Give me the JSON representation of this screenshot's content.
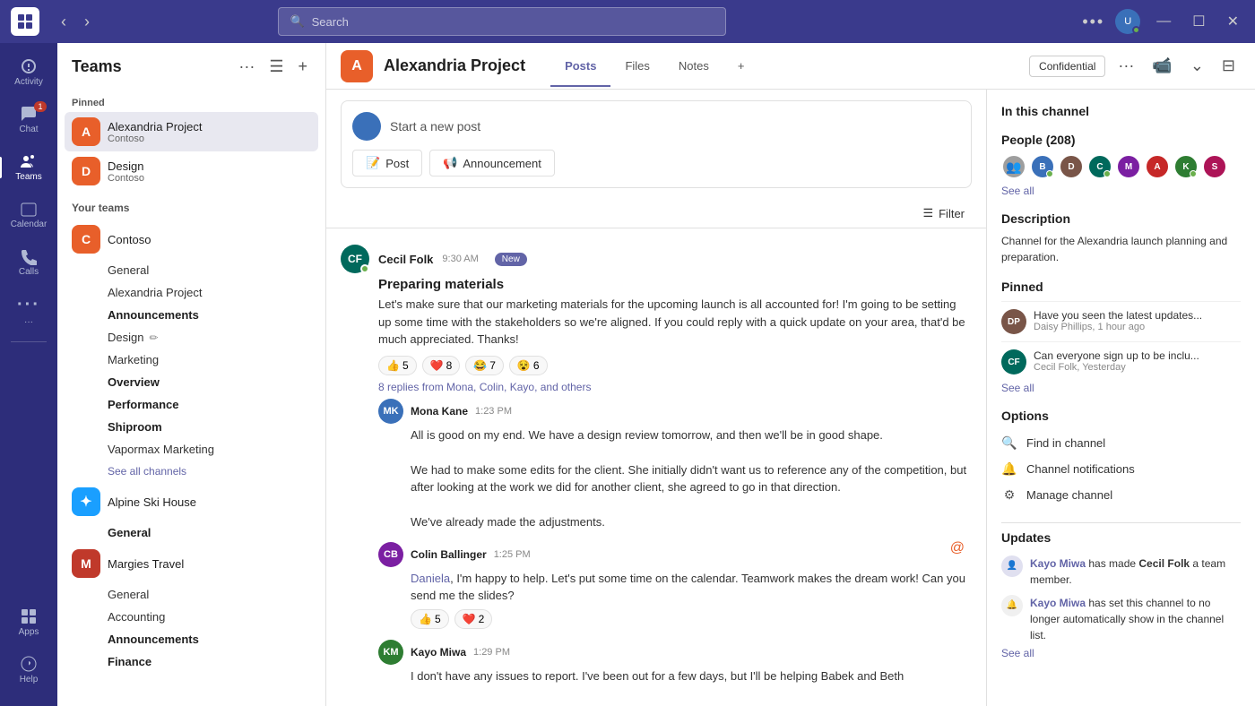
{
  "titlebar": {
    "logo_text": "T",
    "search_placeholder": "Search",
    "dots_label": "•••",
    "avatar_initials": "U",
    "window_minimize": "—",
    "window_maximize": "☐",
    "window_close": "✕"
  },
  "sidebar_icons": {
    "items": [
      {
        "name": "activity",
        "label": "Activity",
        "badge": null
      },
      {
        "name": "chat",
        "label": "Chat",
        "badge": "1"
      },
      {
        "name": "teams",
        "label": "Teams",
        "badge": null
      },
      {
        "name": "calendar",
        "label": "Calendar",
        "badge": null
      },
      {
        "name": "calls",
        "label": "Calls",
        "badge": null
      },
      {
        "name": "more",
        "label": "•••",
        "badge": null
      }
    ],
    "bottom": [
      {
        "name": "apps",
        "label": "Apps",
        "badge": null
      },
      {
        "name": "help",
        "label": "Help",
        "badge": null
      }
    ]
  },
  "teams_nav": {
    "title": "Teams",
    "pinned_label": "Pinned",
    "pinned_items": [
      {
        "name": "Alexandria Project",
        "subtitle": "Contoso",
        "color": "av-orange",
        "initials": "A"
      },
      {
        "name": "Design",
        "subtitle": "Contoso",
        "color": "av-orange",
        "initials": "D"
      }
    ],
    "your_teams_label": "Your teams",
    "teams": [
      {
        "name": "Contoso",
        "color": "av-orange",
        "initials": "C",
        "channels": [
          {
            "name": "General",
            "bold": false
          },
          {
            "name": "Alexandria Project",
            "bold": false
          },
          {
            "name": "Announcements",
            "bold": true
          },
          {
            "name": "Design",
            "bold": false,
            "icon": "✏"
          },
          {
            "name": "Marketing",
            "bold": false
          },
          {
            "name": "Overview",
            "bold": true
          },
          {
            "name": "Performance",
            "bold": true
          },
          {
            "name": "Shiproom",
            "bold": true
          },
          {
            "name": "Vapormax Marketing",
            "bold": false
          }
        ],
        "see_all": "See all channels"
      },
      {
        "name": "Alpine Ski House",
        "color": "av-ski",
        "initials": "✦",
        "channels": [
          {
            "name": "General",
            "bold": true
          }
        ]
      },
      {
        "name": "Margies Travel",
        "color": "av-margies",
        "initials": "M",
        "channels": [
          {
            "name": "General",
            "bold": false
          },
          {
            "name": "Accounting",
            "bold": false
          },
          {
            "name": "Announcements",
            "bold": true
          },
          {
            "name": "Finance",
            "bold": true
          }
        ]
      }
    ]
  },
  "channel_header": {
    "logo_text": "A",
    "title": "Alexandria Project",
    "tabs": [
      "Posts",
      "Files",
      "Notes",
      "+"
    ],
    "active_tab": "Posts",
    "confidential_label": "Confidential",
    "dots": "•••"
  },
  "new_post": {
    "placeholder": "Start a new post",
    "buttons": [
      {
        "icon": "📝",
        "label": "Post"
      },
      {
        "icon": "📢",
        "label": "Announcement"
      }
    ]
  },
  "filter": {
    "label": "Filter"
  },
  "messages": [
    {
      "id": "msg1",
      "author": "Cecil Folk",
      "initials": "CF",
      "color": "av-teal",
      "time": "9:30 AM",
      "is_new": true,
      "online": true,
      "title": "Preparing materials",
      "body": "Let's make sure that our marketing materials for the upcoming launch is all accounted for! I'm going to be setting up some time with the stakeholders so we're aligned. If you could reply with a quick update on your area, that'd be much appreciated. Thanks!",
      "reactions": [
        {
          "emoji": "👍",
          "count": "5"
        },
        {
          "emoji": "❤️",
          "count": "8"
        },
        {
          "emoji": "😂",
          "count": "7"
        },
        {
          "emoji": "😵",
          "count": "6"
        }
      ],
      "replies_text": "8 replies from Mona, Colin, Kayo, and others",
      "replies": [
        {
          "author": "Mona Kane",
          "initials": "MK",
          "color": "av-blue",
          "time": "1:23 PM",
          "body_lines": [
            "All is good on my end. We have a design review tomorrow, and then we'll be in good shape.",
            "We had to make some edits for the client. She initially didn't want us to reference any of the competition, but after looking at the work we did for another client, she agreed to go in that direction.",
            "We've already made the adjustments."
          ],
          "mention": null,
          "reactions": []
        },
        {
          "author": "Colin Ballinger",
          "initials": "CB",
          "color": "av-purple",
          "time": "1:25 PM",
          "body_prefix": "",
          "mention": "Daniela",
          "body_after": ", I'm happy to help. Let's put some time on the calendar. Teamwork makes the dream work! Can you send me the slides?",
          "at_mention": true,
          "reactions": [
            {
              "emoji": "👍",
              "count": "5"
            },
            {
              "emoji": "❤️",
              "count": "2"
            }
          ]
        },
        {
          "author": "Kayo Miwa",
          "initials": "KM",
          "color": "av-green",
          "time": "1:29 PM",
          "body": "I don't have any issues to report. I've been out for a few days, but I'll be helping Babek and Beth",
          "reactions": []
        }
      ]
    }
  ],
  "right_panel": {
    "in_this_channel": "In this channel",
    "people_label": "People (208)",
    "people_count": "208",
    "see_all": "See all",
    "description_title": "Description",
    "description_text": "Channel for the Alexandria launch planning and preparation.",
    "pinned_title": "Pinned",
    "pinned_items": [
      {
        "initials": "DP",
        "color": "av-brown",
        "msg": "Have you seen the latest updates...",
        "sub": "Daisy Phillips, 1 hour ago"
      },
      {
        "initials": "CF",
        "color": "av-teal",
        "msg": "Can everyone sign up to be inclu...",
        "sub": "Cecil Folk, Yesterday"
      }
    ],
    "pinned_see_all": "See all",
    "options_title": "Options",
    "options": [
      {
        "icon": "🔍",
        "label": "Find in channel"
      },
      {
        "icon": "🔔",
        "label": "Channel notifications"
      },
      {
        "icon": "⚙",
        "label": "Manage channel"
      }
    ],
    "updates_title": "Updates",
    "updates": [
      {
        "icon": "👤",
        "text_before": "Kayo Miwa",
        "text_mid": " has made ",
        "text_bold": "Cecil Folk",
        "text_after": " a team member.",
        "color": "av-green"
      },
      {
        "icon": "🔔",
        "text_before": "Kayo Miwa",
        "text_mid": " has set this channel to no longer automatically show in the channel list.",
        "color": "av-green"
      }
    ],
    "updates_see_all": "See all"
  }
}
